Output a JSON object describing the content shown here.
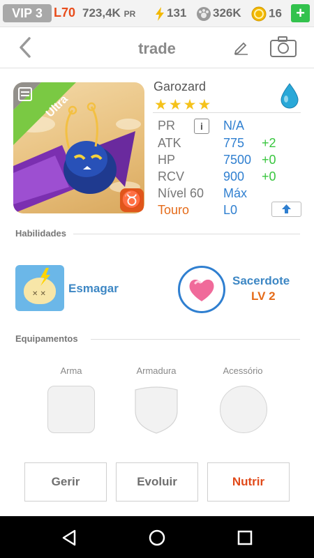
{
  "status_bar": {
    "vip": "VIP 3",
    "level": "L70",
    "power": "723,4K",
    "power_unit": "PR",
    "energy": "131",
    "paws": "326K",
    "coins": "16"
  },
  "header": {
    "title": "trade"
  },
  "monster": {
    "name": "Garozard",
    "rarity": "Ultra",
    "star_count": 4,
    "stars": "★★★★",
    "element": "water",
    "zodiac_symbol": "♉",
    "stats": [
      {
        "label": "PR",
        "value": "N/A",
        "bonus": ""
      },
      {
        "label": "ATK",
        "value": "775",
        "bonus": "+2"
      },
      {
        "label": "HP",
        "value": "7500",
        "bonus": "+0"
      },
      {
        "label": "RCV",
        "value": "900",
        "bonus": "+0"
      },
      {
        "label": "Nível 60",
        "value": "Máx",
        "bonus": ""
      },
      {
        "label": "Touro",
        "value": "L0",
        "bonus": ""
      }
    ]
  },
  "skills": {
    "heading": "Habilidades",
    "primary": {
      "name": "Esmagar"
    },
    "secondary": {
      "name": "Sacerdote",
      "level": "LV 2"
    }
  },
  "equipment": {
    "heading": "Equipamentos",
    "slots": [
      "Arma",
      "Armadura",
      "Acessório"
    ]
  },
  "actions": [
    "Gerir",
    "Evoluir",
    "Nutrir"
  ],
  "colors": {
    "accent_blue": "#2f7fd0",
    "accent_orange": "#e56b19",
    "positive_green": "#38c63e",
    "star_gold": "#f5c21b"
  }
}
